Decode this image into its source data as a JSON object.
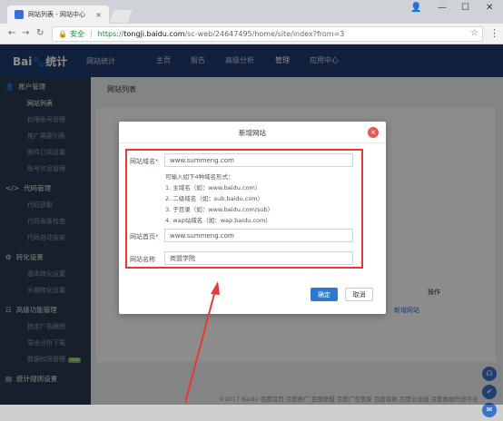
{
  "browser": {
    "tab_title": "网站列表 - 网站中心",
    "tab_close": "×",
    "window_controls": {
      "user": "👤",
      "minimize": "—",
      "maximize": "☐",
      "close": "✕"
    },
    "nav": {
      "back": "←",
      "forward": "→",
      "reload": "↻"
    },
    "secure_label": "安全",
    "separator": "|",
    "url_scheme": "https://",
    "url_host": "tongji.baidu.com",
    "url_path": "/sc-web/24647495/home/site/index?from=3",
    "star": "☆",
    "menu": "⋮"
  },
  "topnav": {
    "logo": "Bai🐾统计",
    "logo_sub": "网站统计",
    "items": [
      "主页",
      "报告",
      "高级分析",
      "管理",
      "应用中心"
    ],
    "active_index": 3
  },
  "sidebar": {
    "groups": [
      {
        "icon": "👤",
        "label": "账户管理",
        "items": [
          "网站列表",
          "权限账号管理",
          "推广屏蔽列表",
          "邮件订阅设置",
          "账号信息管理"
        ]
      },
      {
        "icon": "</>",
        "label": "代码管理",
        "items": [
          "代码获取",
          "代码安装检查",
          "代码自动安装"
        ]
      },
      {
        "icon": "⚙",
        "label": "转化设置",
        "items": [
          "基本转化设置",
          "长期转化设置"
        ]
      },
      {
        "icon": "☷",
        "label": "高级功能管理",
        "items": [
          "指定广告跟踪",
          "导出分析下载",
          "数据权限管理"
        ]
      },
      {
        "icon": "▤",
        "label": "统计规则设置",
        "items": []
      }
    ],
    "new_badge": "new",
    "active_item": "网站列表"
  },
  "content": {
    "title": "网站列表",
    "op_label": "操作",
    "newsite_link": "新增网站",
    "footer": "©2017 Baidu  百度首页  百度推广  百度联盟  百度广告管家  百度指数  百度云加速  百度数据开放平台"
  },
  "float_buttons": [
    "☊",
    "✔",
    "✉"
  ],
  "modal": {
    "title": "新增网站",
    "close": "×",
    "domain_label": "网站域名",
    "domain_value": "www.summeng.com",
    "hints": [
      "可输入如下4种域名形式：",
      "1. 主域名（如：www.baidu.com）",
      "2. 二级域名（如：sub.baidu.com）",
      "3. 子目录（如：www.baidu.com/sub）",
      "4. wap站域名（如：wap.baidu.com）"
    ],
    "home_label": "网站首页",
    "home_value": "www.summeng.com",
    "name_label": "网站名称",
    "name_value": "商盟学院",
    "required_mark": "*",
    "ok": "确定",
    "cancel": "取消"
  },
  "colors": {
    "annotation": "#e53935",
    "nav_bg": "#1f3b6e",
    "sidebar_bg": "#2b3a4f",
    "primary": "#2f78d1"
  }
}
